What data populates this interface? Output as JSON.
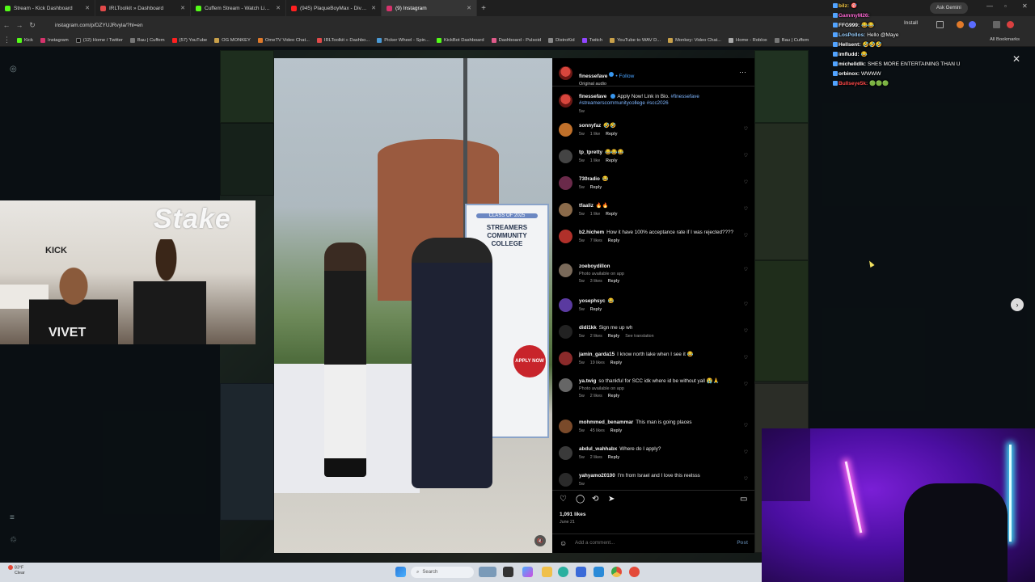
{
  "browser": {
    "tabs": [
      {
        "label": "Stream - Kick Dashboard",
        "color": "#53fc18",
        "active": false
      },
      {
        "label": "IRLToolkit » Dashboard",
        "color": "#e24a4a",
        "active": false
      },
      {
        "label": "Cuffem Stream - Watch Live on",
        "color": "#53fc18",
        "active": false
      },
      {
        "label": "(945) PlaqueBoyMax - Diva (Of",
        "color": "#ff2020",
        "active": false
      },
      {
        "label": "(9) Instagram",
        "color": "#d6336c",
        "active": true
      }
    ],
    "ask_label": "Ask Gemini",
    "url": "instagram.com/p/DZYUJRvyla/?hl=en",
    "install_label": "Install",
    "bookmarks": [
      "Kick",
      "Instagram",
      "(12) Home / Twitter",
      "Bau | Cuffem",
      "(57) YouTube",
      "OG MONKEY",
      "OmeTV Video Chat...",
      "IRLToolkit » Dashbo...",
      "Picker Wheel - Spin...",
      "KickBot Dashboard",
      "Dashboard - Pulsoid",
      "DistroKid",
      "Twitch",
      "YouTube to WAV D...",
      "Monkey: Video Chat...",
      "Home - Roblox",
      "Bau | Cuffem"
    ],
    "all_bookmarks": "All Bookmarks"
  },
  "post": {
    "author": "finessefave",
    "follow_label": "Follow",
    "audio": "Original audio",
    "caption_user": "finessefave",
    "caption": "Apply Now! Link in Bio.",
    "caption_tags": "#finessefave #streamerscommunitycollege #scc2026",
    "caption_time": "5w",
    "media_text": {
      "class_of": "CLASS OF 2025",
      "college": "STREAMERS COMMUNITY COLLEGE",
      "apply": "APPLY NOW"
    },
    "comments": [
      {
        "user": "sonnyfaz",
        "text": "🤣🤣",
        "time": "5w",
        "likes": "1 like",
        "reply": "Reply",
        "color": "#c0702a"
      },
      {
        "user": "tp_tpretty",
        "text": "😂😂😂",
        "time": "5w",
        "likes": "1 like",
        "reply": "Reply",
        "color": "#444"
      },
      {
        "user": "730radio",
        "text": "😂",
        "time": "5w",
        "likes": "",
        "reply": "Reply",
        "color": "#6a2a4a"
      },
      {
        "user": "tfaaliz",
        "text": "🔥🔥",
        "time": "5w",
        "likes": "1 like",
        "reply": "Reply",
        "color": "#8a6a4a"
      },
      {
        "user": "b2.hichem",
        "text": "How it have 100% acceptance rate if I was rejected????",
        "time": "5w",
        "likes": "7 likes",
        "reply": "Reply",
        "color": "#b0302a"
      },
      {
        "user": "zoeboydillon",
        "text": "",
        "note": "Photo available on app",
        "time": "5w",
        "likes": "3 likes",
        "reply": "Reply",
        "color": "#7a6a5a"
      },
      {
        "user": "yosephsyc",
        "text": "😂",
        "time": "5w",
        "likes": "",
        "reply": "Reply",
        "color": "#5a3aa0"
      },
      {
        "user": "didi1kk",
        "text": "Sign me up wh",
        "time": "5w",
        "likes": "2 likes",
        "reply": "Reply",
        "extra": "See translation",
        "color": "#222"
      },
      {
        "user": "jamin_garda15",
        "text": "I know north lake when I see it 😂",
        "time": "5w",
        "likes": "19 likes",
        "reply": "Reply",
        "color": "#8a2a2a"
      },
      {
        "user": "ya.twig",
        "text": "so thankful for SCC idk where id be without yall 😭🙏",
        "note": "Photo available on app",
        "time": "5w",
        "likes": "2 likes",
        "reply": "Reply",
        "color": "#666"
      },
      {
        "user": "mohmmed_benammar",
        "text": "This man is going places",
        "time": "5w",
        "likes": "45 likes",
        "reply": "Reply",
        "color": "#7a4a2a"
      },
      {
        "user": "abdul_wahhabx",
        "text": "Where do I apply?",
        "time": "5w",
        "likes": "2 likes",
        "reply": "Reply",
        "color": "#3a3a3a"
      },
      {
        "user": "yahyamo20100",
        "text": "I'm from Israel and I love this reelsss",
        "time": "5w",
        "likes": "",
        "reply": "",
        "color": "#2a2a2a"
      }
    ],
    "likes": "1,091 likes",
    "date": "June 21",
    "add_comment_placeholder": "Add a comment...",
    "post_label": "Post"
  },
  "chat": [
    {
      "user": "bilz:",
      "msg": "🎯",
      "color": "#ffd24a"
    },
    {
      "user": "GammyM26:",
      "msg": "",
      "color": "#ff6ad5"
    },
    {
      "user": "FFG999:",
      "msg": "😂😂",
      "color": "#ffffff"
    },
    {
      "user": "LosPollos:",
      "msg": "Hello @Maye",
      "color": "#9ad0ff"
    },
    {
      "user": "Hellsent:",
      "msg": "🤣🤣🤣",
      "color": "#ffffff"
    },
    {
      "user": "imfludd:",
      "msg": "😂",
      "color": "#ffffff"
    },
    {
      "user": "michelldlk:",
      "msg": "SHES MORE ENTERTAINING THAN U",
      "color": "#ffffff"
    },
    {
      "user": "orbinox:",
      "msg": "WWWW",
      "color": "#ffffff"
    },
    {
      "user": "Bullseye5k:",
      "msg": "🟢🟢🟢",
      "color": "#ff4a4a"
    }
  ],
  "stream": {
    "cam1_sign": "Stake",
    "cam1_wall": "KICK",
    "cam1_shirt": "VIVET"
  },
  "taskbar": {
    "temp": "83°F",
    "condition": "Clear",
    "search_placeholder": "Search"
  }
}
